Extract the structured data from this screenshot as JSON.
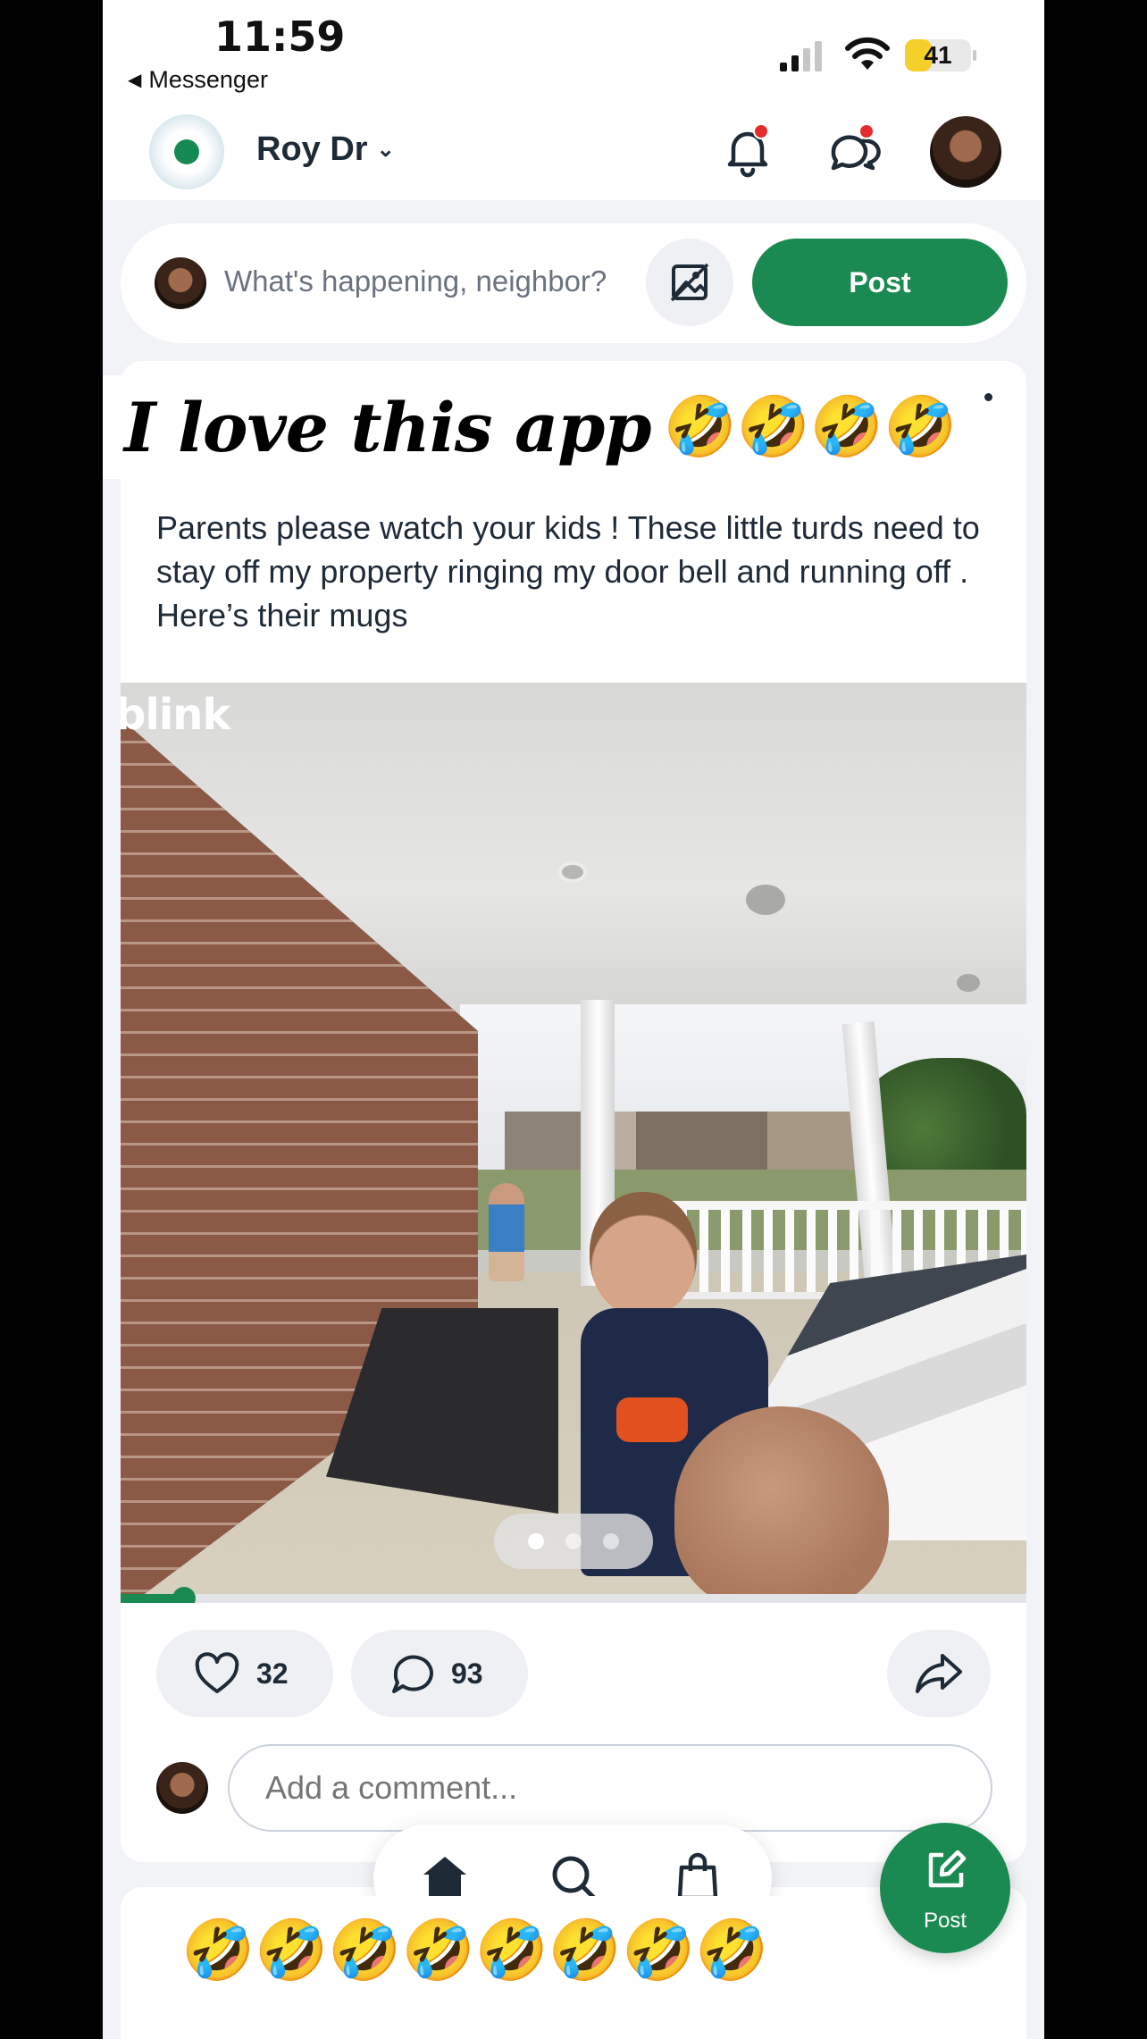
{
  "status_bar": {
    "time": "11:59",
    "back_app": "Messenger",
    "battery_level": "41",
    "battery_fraction": 0.41,
    "signal_bars_on": 2,
    "signal_bars_total": 4
  },
  "header": {
    "neighborhood": "Roy Dr",
    "notifications_unread": true,
    "messages_unread": true
  },
  "composer": {
    "placeholder": "What's happening, neighbor?",
    "post_label": "Post"
  },
  "post": {
    "overlay_title": "I love this app",
    "overlay_emoji": "🤣🤣🤣🤣",
    "body": "Parents please watch your kids ! These little turds need to stay off my property ringing my door bell and running off . Here’s their mugs",
    "media": {
      "watermark": "blink",
      "page_count": 3,
      "current_page": 1,
      "playback_progress": 0.07
    },
    "likes": "32",
    "comments": "93",
    "comment_placeholder": "Add a comment..."
  },
  "overlay_caption_emoji": "🤣🤣🤣🤣🤣🤣🤣🤣",
  "bottom_nav": {
    "items": [
      {
        "icon": "home-icon",
        "active": true
      },
      {
        "icon": "search-icon",
        "active": false
      },
      {
        "icon": "shopping-bag-icon",
        "active": false
      }
    ]
  },
  "fab": {
    "label": "Post"
  },
  "colors": {
    "brand_green": "#1b8a52",
    "notification_red": "#e52d2d",
    "battery_yellow": "#f5cf2a"
  }
}
